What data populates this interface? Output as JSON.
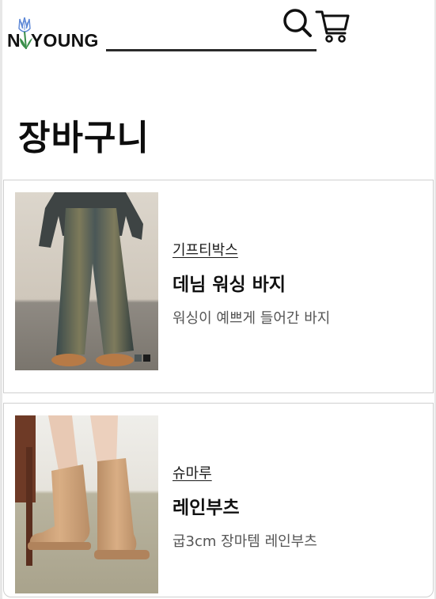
{
  "header": {
    "logo_text": "N  YOUNG",
    "search": {
      "value": "",
      "placeholder": ""
    }
  },
  "page": {
    "title": "장바구니"
  },
  "cart": {
    "items": [
      {
        "brand": "기프티박스",
        "name": "데님 워싱 바지",
        "description": "워싱이 예쁘게 들어간 바지"
      },
      {
        "brand": "슈마루",
        "name": "레인부츠",
        "description": "굽3cm 장마템 레인부츠"
      }
    ]
  },
  "colors": {
    "text_primary": "#111111",
    "text_secondary": "#555555",
    "logo_flower": "#5b86d6",
    "logo_leaf": "#3a8f4a",
    "border": "#cfcfcf"
  }
}
